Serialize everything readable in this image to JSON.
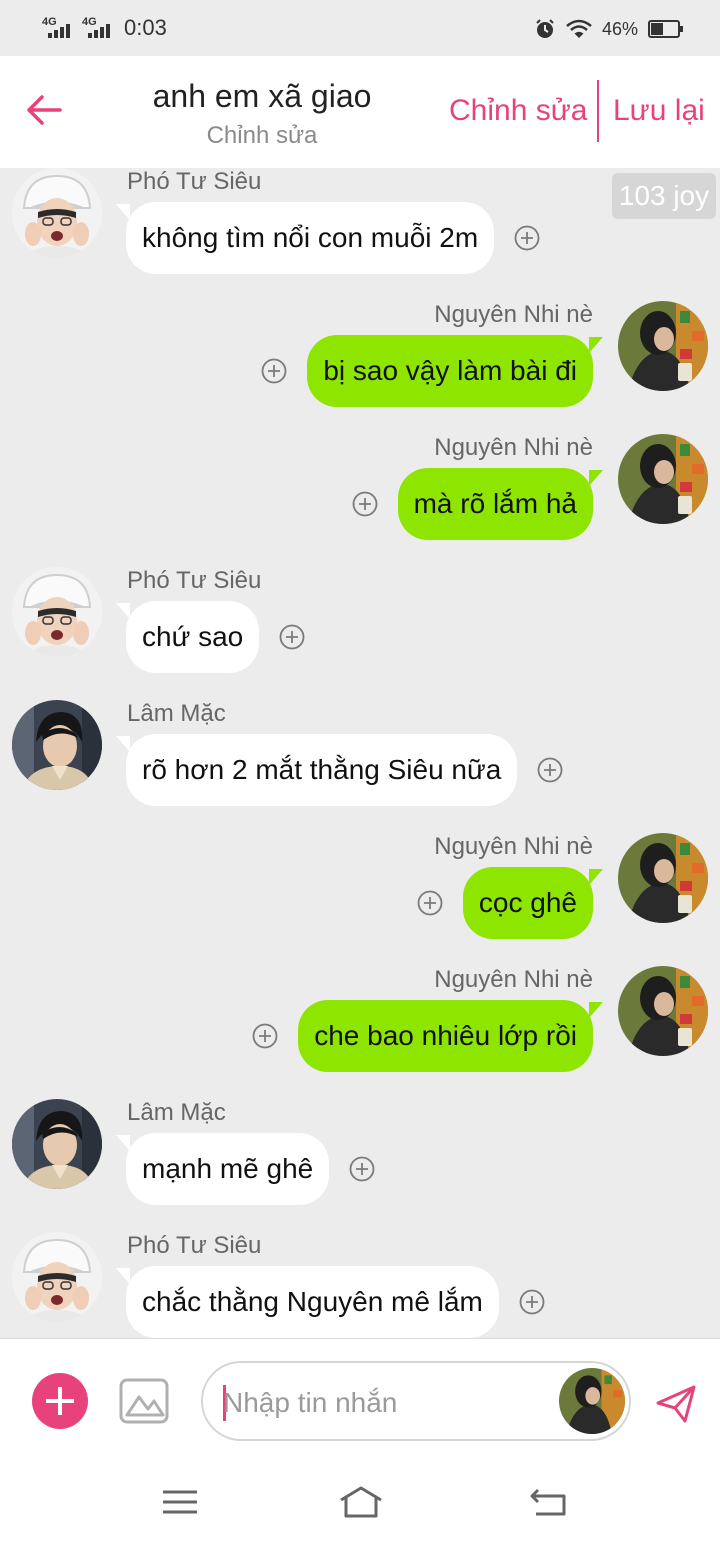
{
  "status_bar": {
    "signal_1": "4G",
    "signal_2": "4G",
    "time": "0:03",
    "battery_percent": "46%",
    "battery_level": 0.46,
    "icons": [
      "alarm-icon",
      "wifi-icon",
      "battery-icon"
    ]
  },
  "header": {
    "title": "anh em xã giao",
    "subtitle": "Chỉnh sửa",
    "edit_label": "Chỉnh sửa",
    "save_label": "Lưu lại",
    "back_icon": "back-arrow-icon",
    "accent": "#e8427c"
  },
  "chat": {
    "joy_badge": "103 joy",
    "messages": [
      {
        "side": "left",
        "sender": "Phó Tư Siêu",
        "text": "không tìm nổi con muỗi 2m"
      },
      {
        "side": "right",
        "sender": "Nguyên Nhi nè",
        "text": "bị sao vậy làm bài đi"
      },
      {
        "side": "right",
        "sender": "Nguyên Nhi nè",
        "text": "mà rõ lắm hả"
      },
      {
        "side": "left",
        "sender": "Phó Tư Siêu",
        "text": "chứ sao"
      },
      {
        "side": "left",
        "sender": "Lâm Mặc",
        "text": "rõ hơn 2 mắt thằng Siêu nữa"
      },
      {
        "side": "right",
        "sender": "Nguyên Nhi nè",
        "text": "cọc ghê"
      },
      {
        "side": "right",
        "sender": "Nguyên Nhi nè",
        "text": "che bao nhiêu lớp rồi"
      },
      {
        "side": "left",
        "sender": "Lâm Mặc",
        "text": "mạnh mẽ ghê"
      },
      {
        "side": "left",
        "sender": "Phó Tư Siêu",
        "text": "chắc thằng Nguyên mê lắm"
      }
    ],
    "colors": {
      "own_bubble": "#8ee500",
      "other_bubble": "#ffffff",
      "background": "#ececec"
    }
  },
  "composer": {
    "placeholder": "Nhập tin nhắn",
    "icons": [
      "plus-icon",
      "image-icon",
      "send-icon"
    ]
  },
  "nav_bar": {
    "icons": [
      "menu-icon",
      "home-icon",
      "back-icon"
    ]
  }
}
